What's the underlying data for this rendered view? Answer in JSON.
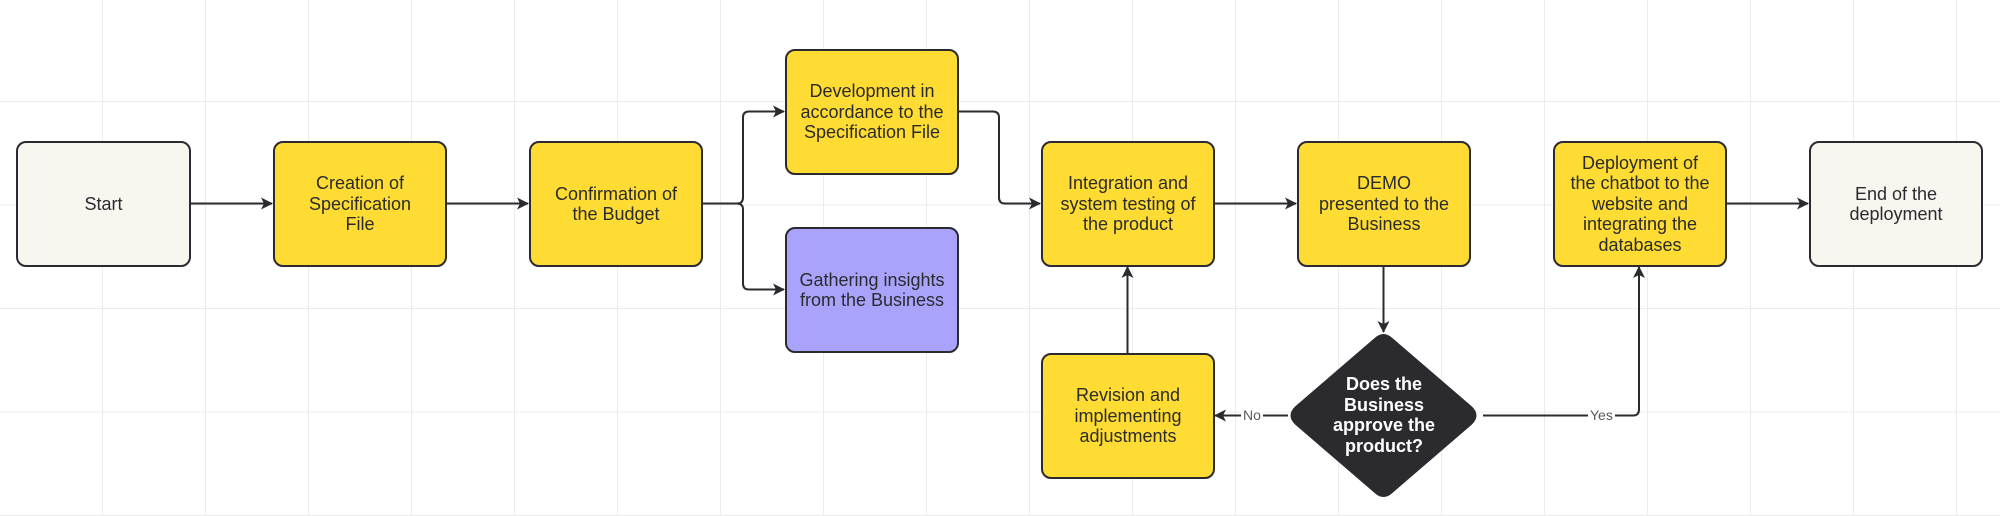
{
  "diagram": {
    "type": "flowchart",
    "colors": {
      "terminal_fill": "#f9f6f0",
      "process_fill": "#fedc33",
      "insight_fill": "#a9a3fb",
      "decision_fill": "#2b2b2f",
      "stroke": "#2b2b2f",
      "grid": "#ececec"
    },
    "nodes": {
      "start": {
        "label": "Start",
        "kind": "terminal"
      },
      "creation": {
        "label": "Creation of Specification File",
        "kind": "process"
      },
      "budget": {
        "label": "Confirmation of the Budget",
        "kind": "process"
      },
      "development": {
        "label": "Development in accordance to the Specification File",
        "kind": "process"
      },
      "gathering": {
        "label": "Gathering insights from the Business",
        "kind": "process"
      },
      "integration": {
        "label": "Integration and system testing of the product",
        "kind": "process"
      },
      "demo": {
        "label": "DEMO presented to the Business",
        "kind": "process"
      },
      "deployment": {
        "label": "Deployment of the chatbot to the website and integrating the databases",
        "kind": "process"
      },
      "end": {
        "label": "End of the deployment",
        "kind": "terminal"
      },
      "revision": {
        "label": "Revision and implementing adjustments",
        "kind": "process"
      },
      "decision": {
        "label": "Does the Business approve the product?",
        "kind": "decision"
      }
    },
    "edges": [
      {
        "from": "start",
        "to": "creation",
        "label": ""
      },
      {
        "from": "creation",
        "to": "budget",
        "label": ""
      },
      {
        "from": "budget",
        "to": "development",
        "label": ""
      },
      {
        "from": "budget",
        "to": "gathering",
        "label": ""
      },
      {
        "from": "development",
        "to": "integration",
        "label": ""
      },
      {
        "from": "integration",
        "to": "demo",
        "label": ""
      },
      {
        "from": "demo",
        "to": "decision",
        "label": ""
      },
      {
        "from": "decision",
        "to": "revision",
        "label": "No"
      },
      {
        "from": "decision",
        "to": "deployment",
        "label": "Yes"
      },
      {
        "from": "revision",
        "to": "integration",
        "label": ""
      },
      {
        "from": "deployment",
        "to": "end",
        "label": ""
      }
    ],
    "edge_labels": {
      "no": "No",
      "yes": "Yes"
    }
  }
}
